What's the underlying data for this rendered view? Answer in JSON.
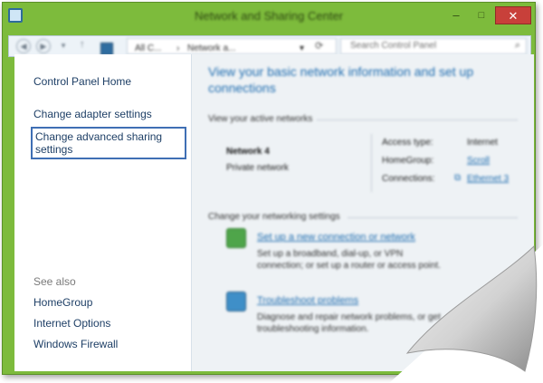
{
  "window": {
    "title": "Network and Sharing Center",
    "accent_color": "#7dbb3c",
    "controls": {
      "minimize": "–",
      "maximize": "□",
      "close": "✕"
    }
  },
  "navbar": {
    "back_icon": "back-arrow-icon",
    "forward_icon": "forward-arrow-icon",
    "up_icon": "up-arrow-icon",
    "breadcrumb": [
      "All C...",
      "Network a..."
    ],
    "search_placeholder": "Search Control Panel"
  },
  "sidebar": {
    "home_link": "Control Panel Home",
    "links": [
      "Change adapter settings",
      "Change advanced sharing settings"
    ],
    "see_also_label": "See also",
    "see_also_links": [
      "HomeGroup",
      "Internet Options",
      "Windows Firewall"
    ]
  },
  "content": {
    "heading": "View your basic network information and set up connections",
    "active_networks_label": "View your active networks",
    "network": {
      "name": "Network 4",
      "type": "Private network",
      "access_type_label": "Access type:",
      "access_type_value": "Internet",
      "homegroup_label": "HomeGroup:",
      "homegroup_value": "Scroll",
      "connections_label": "Connections:",
      "connections_value": "Ethernet 3"
    },
    "change_settings_label": "Change your networking settings",
    "tasks": [
      {
        "title": "Set up a new connection or network",
        "desc": "Set up a broadband, dial-up, or VPN connection; or set up a router or access point.",
        "icon": "network-setup-icon"
      },
      {
        "title": "Troubleshoot problems",
        "desc": "Diagnose and repair network problems, or get troubleshooting information.",
        "icon": "troubleshoot-icon"
      }
    ]
  }
}
